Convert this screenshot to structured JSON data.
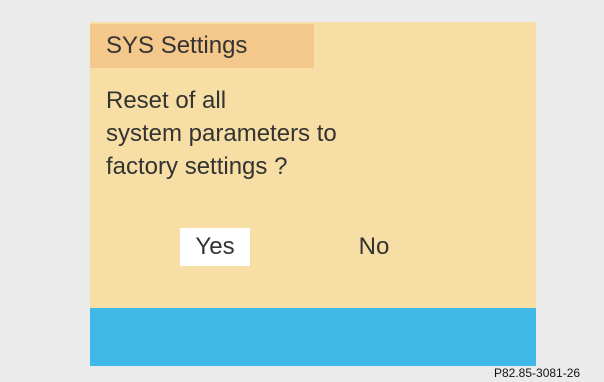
{
  "dialog": {
    "title": "SYS Settings",
    "message_lines": [
      "Reset of all",
      "system parameters to",
      "factory settings ?"
    ],
    "yes_label": "Yes",
    "no_label": "No",
    "selected": "Yes"
  },
  "figure_ref": "P82.85-3081-26",
  "colors": {
    "screen_bg": "#f6dea4",
    "title_bg": "#f4c78a",
    "status_bar": "#41b9e8",
    "selected_bg": "#ffffff",
    "page_bg": "#ebebeb"
  }
}
